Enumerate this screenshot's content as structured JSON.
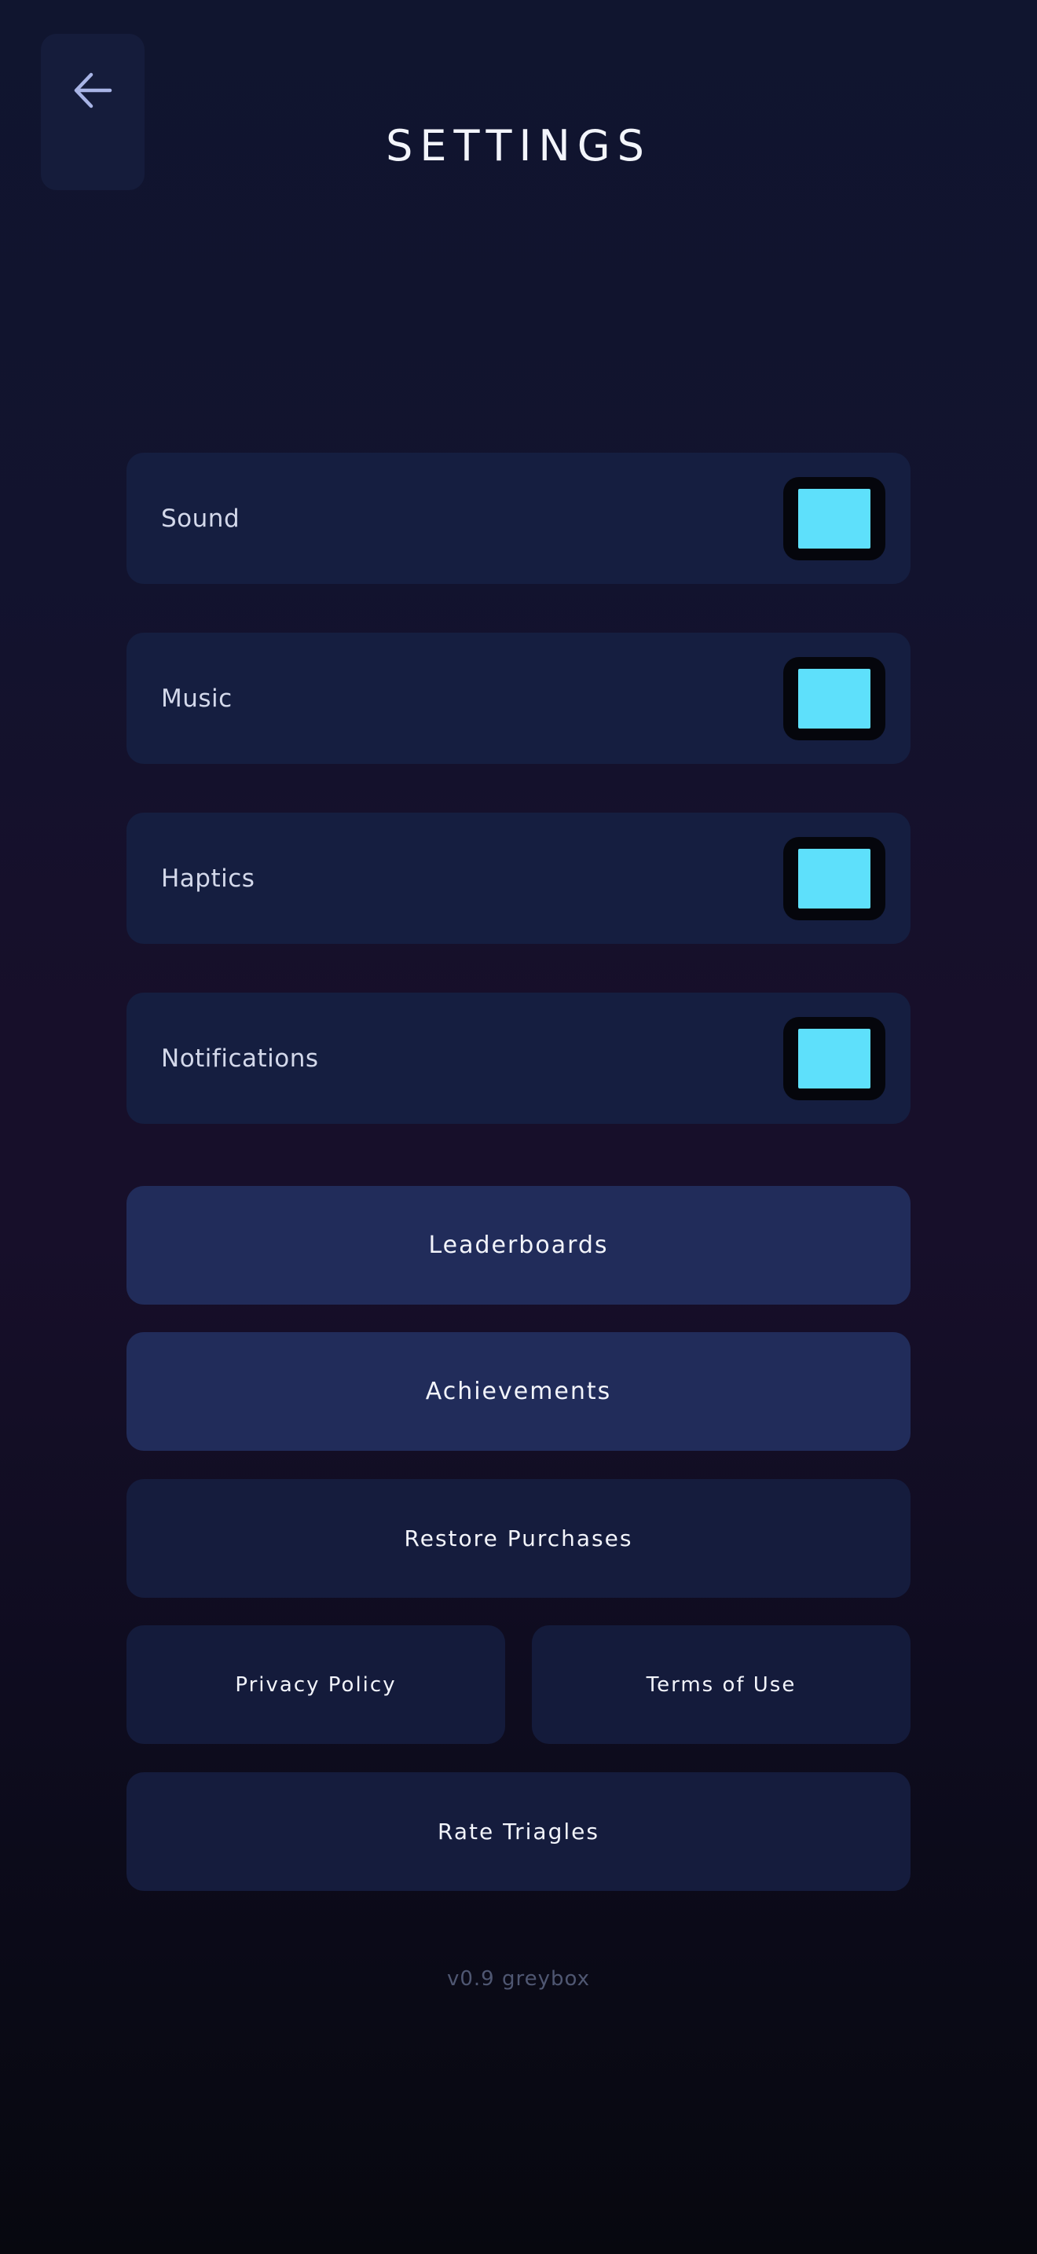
{
  "header": {
    "back_icon": "arrow-left-icon",
    "title": "SETTINGS"
  },
  "toggles": [
    {
      "label": "Sound",
      "on": true
    },
    {
      "label": "Music",
      "on": true
    },
    {
      "label": "Haptics",
      "on": true
    },
    {
      "label": "Notifications",
      "on": true
    }
  ],
  "buttons": {
    "leaderboards": "Leaderboards",
    "achievements": "Achievements",
    "restore_purchases": "Restore Purchases",
    "privacy_policy": "Privacy Policy",
    "terms_of_use": "Terms of Use",
    "rate": "Rate Triagles"
  },
  "footer": {
    "version": "v0.9 greybox"
  },
  "colors": {
    "toggle_on": "#5ee0fb",
    "primary_button": "#212c5a",
    "secondary_button": "#151c3d"
  }
}
